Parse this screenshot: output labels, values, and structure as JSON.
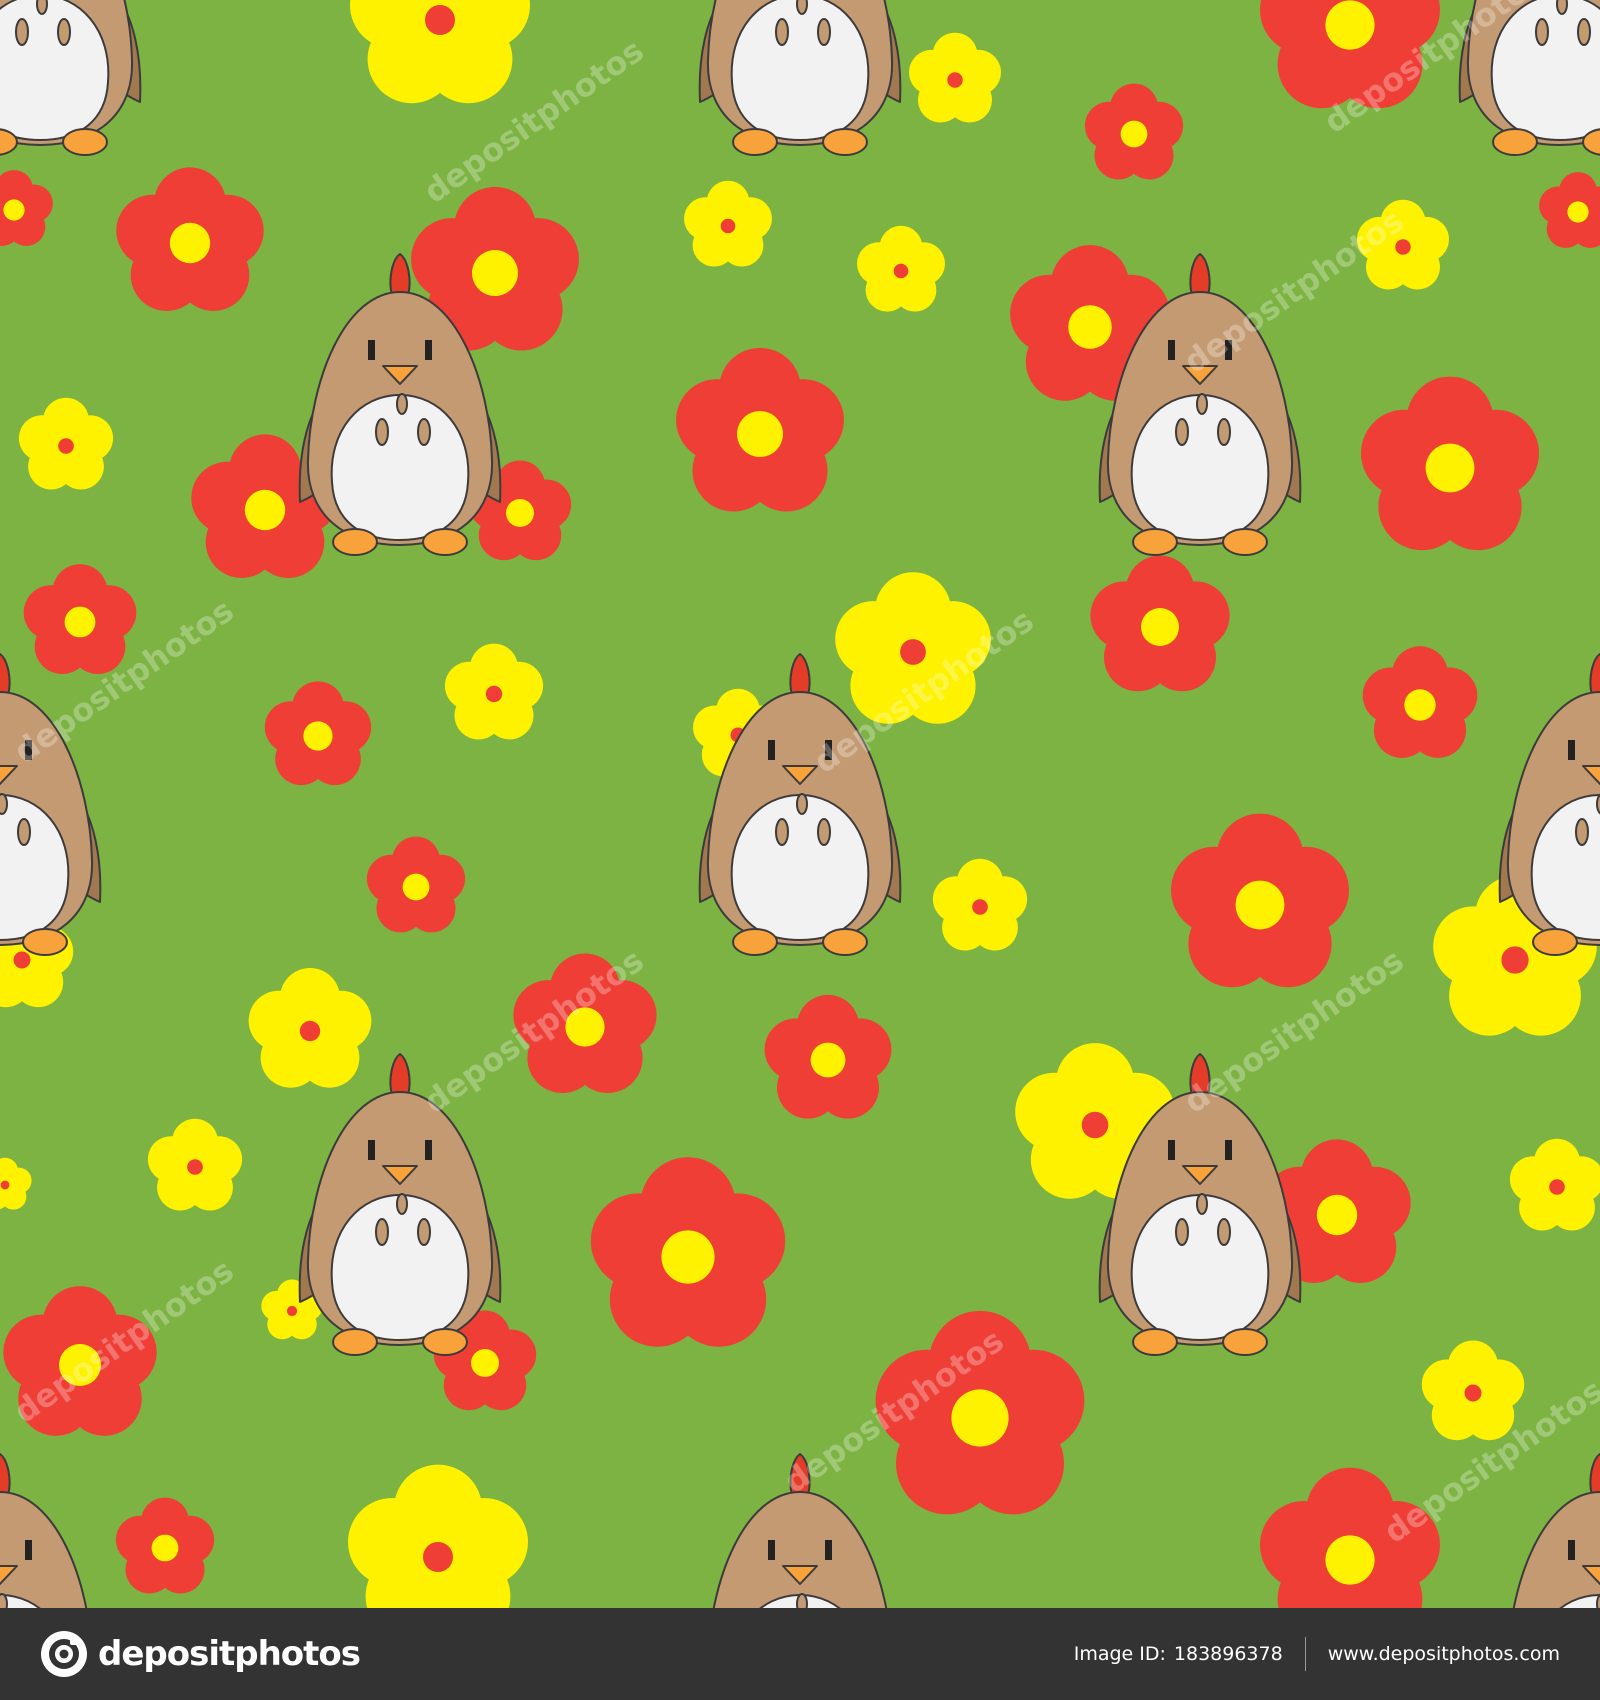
{
  "background": {
    "color": "#7cb342",
    "pattern": "seamless cartoon chickens with red and yellow flowers"
  },
  "colors": {
    "grass": "#7cb342",
    "flower_red": "#ef3e36",
    "flower_yellow": "#fff200",
    "chicken_body": "#c49a72",
    "chicken_wing": "#a27850",
    "chicken_belly": "#f2f2f2",
    "beak_feet": "#f7a23a",
    "comb": "#e53c2a",
    "outline": "#3b3b3b",
    "footer_bg": "#333333"
  },
  "watermark": {
    "text": "depositphotos"
  },
  "footer": {
    "logo_icon": "depositphotos-logo-icon",
    "brand": "depositphotos",
    "image_id_label": "Image ID:",
    "image_id": "183896378",
    "website": "www.depositphotos.com"
  }
}
